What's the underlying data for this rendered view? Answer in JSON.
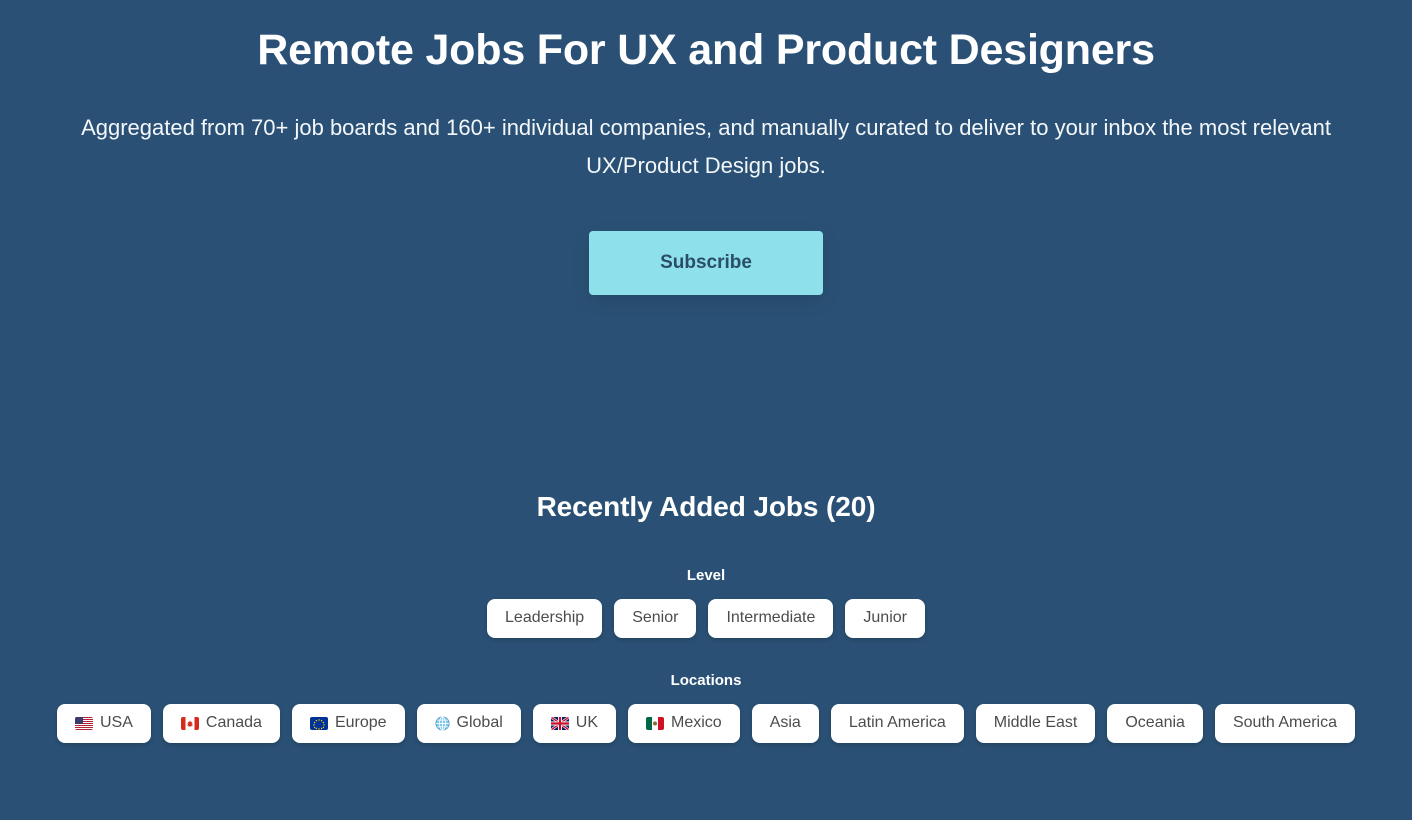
{
  "theme": {
    "background": "#2a5175",
    "accent": "#8ee1ea",
    "chip_background": "#ffffff",
    "chip_text": "#4c4c4c",
    "heading_text": "#ffffff"
  },
  "hero": {
    "title": "Remote Jobs For UX and Product Designers",
    "subtitle": "Aggregated from 70+ job boards and 160+ individual companies, and manually curated to deliver to your inbox the most relevant UX/Product Design jobs.",
    "subscribe_label": "Subscribe"
  },
  "jobs": {
    "heading": "Recently Added Jobs (20)",
    "count": 20,
    "filters": [
      {
        "id": "level",
        "label": "Level",
        "chips": [
          {
            "label": "Leadership",
            "icon": null
          },
          {
            "label": "Senior",
            "icon": null
          },
          {
            "label": "Intermediate",
            "icon": null
          },
          {
            "label": "Junior",
            "icon": null
          }
        ]
      },
      {
        "id": "locations",
        "label": "Locations",
        "chips": [
          {
            "label": "USA",
            "icon": "flag-usa-icon"
          },
          {
            "label": "Canada",
            "icon": "flag-canada-icon"
          },
          {
            "label": "Europe",
            "icon": "flag-europe-icon"
          },
          {
            "label": "Global",
            "icon": "globe-icon"
          },
          {
            "label": "UK",
            "icon": "flag-uk-icon"
          },
          {
            "label": "Mexico",
            "icon": "flag-mexico-icon"
          },
          {
            "label": "Asia",
            "icon": null
          },
          {
            "label": "Latin America",
            "icon": null
          },
          {
            "label": "Middle East",
            "icon": null
          },
          {
            "label": "Oceania",
            "icon": null
          },
          {
            "label": "South America",
            "icon": null
          }
        ]
      }
    ]
  }
}
